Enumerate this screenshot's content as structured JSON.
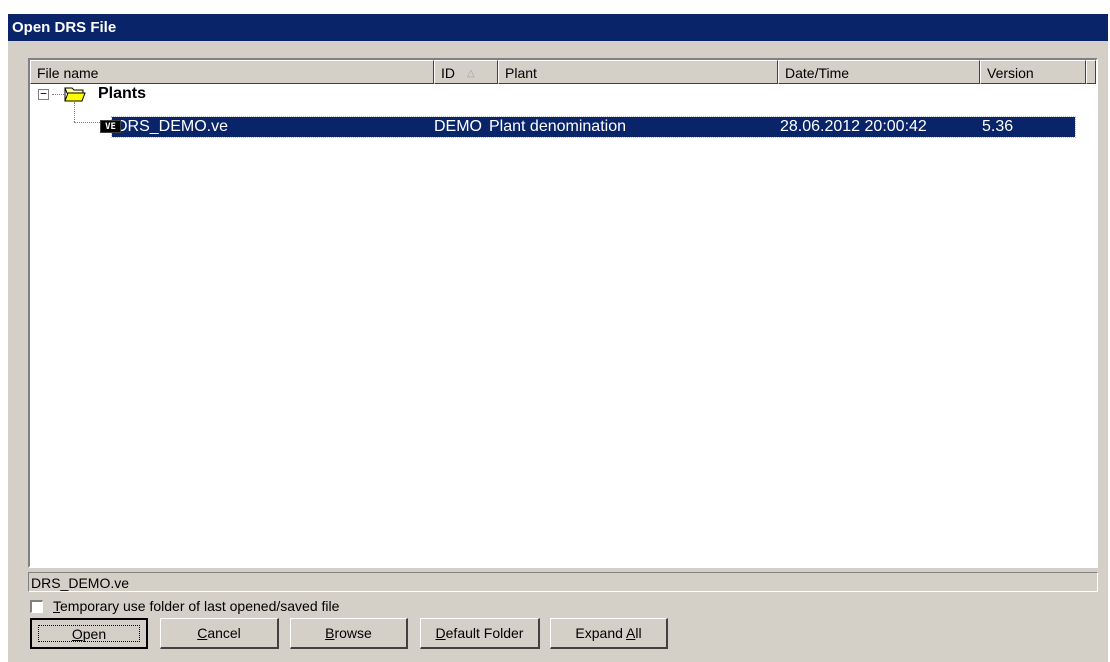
{
  "window": {
    "title": "Open DRS File"
  },
  "columns": [
    {
      "label": "File name"
    },
    {
      "label": "ID",
      "sort_icon": "sort-ascending-triangle"
    },
    {
      "label": "Plant"
    },
    {
      "label": "Date/Time"
    },
    {
      "label": "Version"
    }
  ],
  "tree": {
    "folder": {
      "label": "Plants",
      "toggle": "−",
      "icon": "folder-open-icon"
    },
    "file": {
      "badge": "VE",
      "icon": "ve-file-icon",
      "name": "DRS_DEMO.ve",
      "id": "DEMO",
      "plant": "Plant denomination",
      "datetime": "28.06.2012 20:00:42",
      "version": "5.36"
    }
  },
  "path_display": "DRS_DEMO.ve",
  "checkbox": {
    "label_first": "T",
    "label_rest": "emporary use folder of last opened/saved file",
    "checked": false
  },
  "buttons": {
    "open": {
      "u": "O",
      "rest": "pen"
    },
    "cancel": {
      "u": "C",
      "rest": "ancel"
    },
    "browse": {
      "u": "B",
      "rest": "rowse"
    },
    "default_folder": {
      "u": "D",
      "rest": "efault Folder"
    },
    "expand_all": {
      "pre": "Expand ",
      "u": "A",
      "rest": "ll"
    }
  },
  "colors": {
    "titlebar": "#0a246a",
    "face": "#d4d0c8",
    "selection": "#0a246a"
  }
}
